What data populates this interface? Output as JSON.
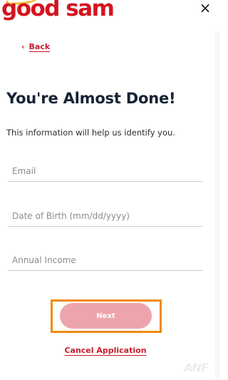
{
  "brand": {
    "logo_text": "good sam",
    "accent": "#d4141f",
    "halo": "#f2b830"
  },
  "header": {
    "close_icon": "×"
  },
  "nav": {
    "back_chevron": "‹",
    "back_label": "Back"
  },
  "main": {
    "title": "You're Almost Done!",
    "subtitle": "This information will help us identify you."
  },
  "form": {
    "email_placeholder": "Email",
    "dob_placeholder": "Date of Birth (mm/dd/yyyy)",
    "income_placeholder": "Annual Income",
    "next_label": "Next",
    "cancel_label": "Cancel Application"
  },
  "colors": {
    "title": "#172234",
    "link": "#c81b2a",
    "button_disabled": "#eea4ad",
    "focus_outline": "#f28a0e"
  }
}
